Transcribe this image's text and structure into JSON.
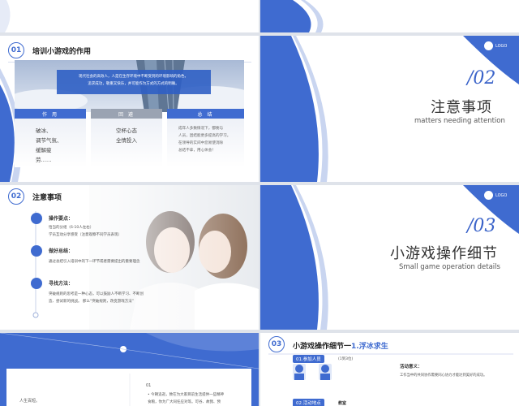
{
  "slide_top_row": {},
  "slide_purpose": {
    "number": "01",
    "title": "培训小游戏的作用",
    "banner_text": "现代社会的高效人，人是在生存环境中不断受到的环境影响的角色，\n追求成功，敬重又快乐，并可能作为方式的方式的明确。",
    "columns": [
      {
        "header": "作 用",
        "text": "破冰、\n调节气氛、\n缓解疲\n劳……"
      },
      {
        "header": "回 避",
        "text": "空杯心态\n全情投入"
      },
      {
        "header": "总 结",
        "text": "成年人多数情况下，都要与\n人员，团结能更多提高的学习。\n在领导的实间中您易使消除\n总结不拿，用心体会！"
      }
    ]
  },
  "slide_section2": {
    "number": "/02",
    "title": "注意事项",
    "subtitle": "matters needing attention",
    "logo": "LOGO"
  },
  "slide_notes": {
    "number": "02",
    "title": "注意事项",
    "items": [
      {
        "title": "操作要点：",
        "text": "恰当的分组（6-10人左右）\n学员互动分享感受（注意观察不同学员表现）"
      },
      {
        "title": "做好总结：",
        "text": "通过总结引入培训中的下一环节或者需要提出的重要理念"
      },
      {
        "title": "寻找方法：",
        "text": "突破规则的思考是一种心态，可以鼓励人不断学习、不断创\n造、尝试新的挑战。 那么“突破规则，改变游戏方法”"
      }
    ]
  },
  "slide_section3": {
    "number": "/03",
    "title": "小游戏操作细节",
    "subtitle": "Small game operation details",
    "logo": "LOGO"
  },
  "slide_bottom_left": {
    "left_text": "人生百短。",
    "marker": "01",
    "bullet": "• 今朝追逝，致在为大家目前生活提供一些精神\n  食粮，你为广大同任应对等。可谷、故我、预"
  },
  "slide_detail": {
    "number": "03",
    "title_prefix": "小游戏操作细节一",
    "title_highlight": "1.浮冰求生",
    "tag1": "01.参加人员",
    "people_note": "(1到3位)",
    "meaning_title": "活动意义：",
    "meaning_text": "工作当中的共同协作需要同心协力才能达到美好的成功。",
    "tag2": "02.活动地点",
    "venue_label": "教室"
  }
}
